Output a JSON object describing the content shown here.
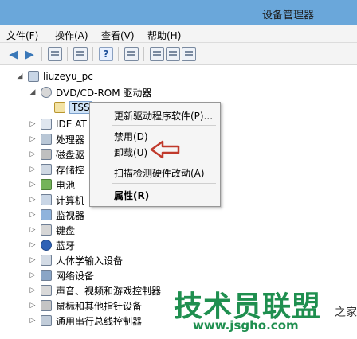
{
  "window": {
    "title": "设备管理器"
  },
  "menu": [
    "文件(F)",
    "操作(A)",
    "查看(V)",
    "帮助(H)"
  ],
  "toolbar": {
    "icons": [
      "back-arrow-icon",
      "forward-arrow-icon",
      "properties-icon",
      "update-driver-icon",
      "help-icon",
      "scan-hardware-icon",
      "disable-device-icon",
      "uninstall-device-icon",
      "enable-device-icon"
    ]
  },
  "tree": {
    "root": "liuzeyu_pc",
    "categories": [
      {
        "label": "DVD/CD-ROM 驱动器",
        "expanded": true
      },
      {
        "label": "TSS",
        "child": true,
        "selected": true
      },
      {
        "label": "IDE AT"
      },
      {
        "label": "处理器"
      },
      {
        "label": "磁盘驱"
      },
      {
        "label": "存储控"
      },
      {
        "label": "电池"
      },
      {
        "label": "计算机"
      },
      {
        "label": "监视器"
      },
      {
        "label": "键盘"
      },
      {
        "label": "蓝牙"
      },
      {
        "label": "人体学输入设备"
      },
      {
        "label": "网络设备"
      },
      {
        "label": "声音、视频和游戏控制器"
      },
      {
        "label": "鼠标和其他指针设备"
      },
      {
        "label": "通用串行总线控制器"
      }
    ]
  },
  "context_menu": {
    "items": [
      {
        "label": "更新驱动程序软件(P)..."
      },
      {
        "label": "禁用(D)"
      },
      {
        "label": "卸载(U)"
      },
      {
        "label": "扫描检测硬件改动(A)"
      },
      {
        "label": "属性(R)",
        "bold": true
      }
    ]
  },
  "watermark": {
    "main": "技术员联盟",
    "sub": "之家",
    "url": "www.jsgho.com"
  },
  "colors": {
    "titlebar": "#6aa7da",
    "accent_arrow": "#c0392b",
    "watermark": "#1f8f4f"
  }
}
